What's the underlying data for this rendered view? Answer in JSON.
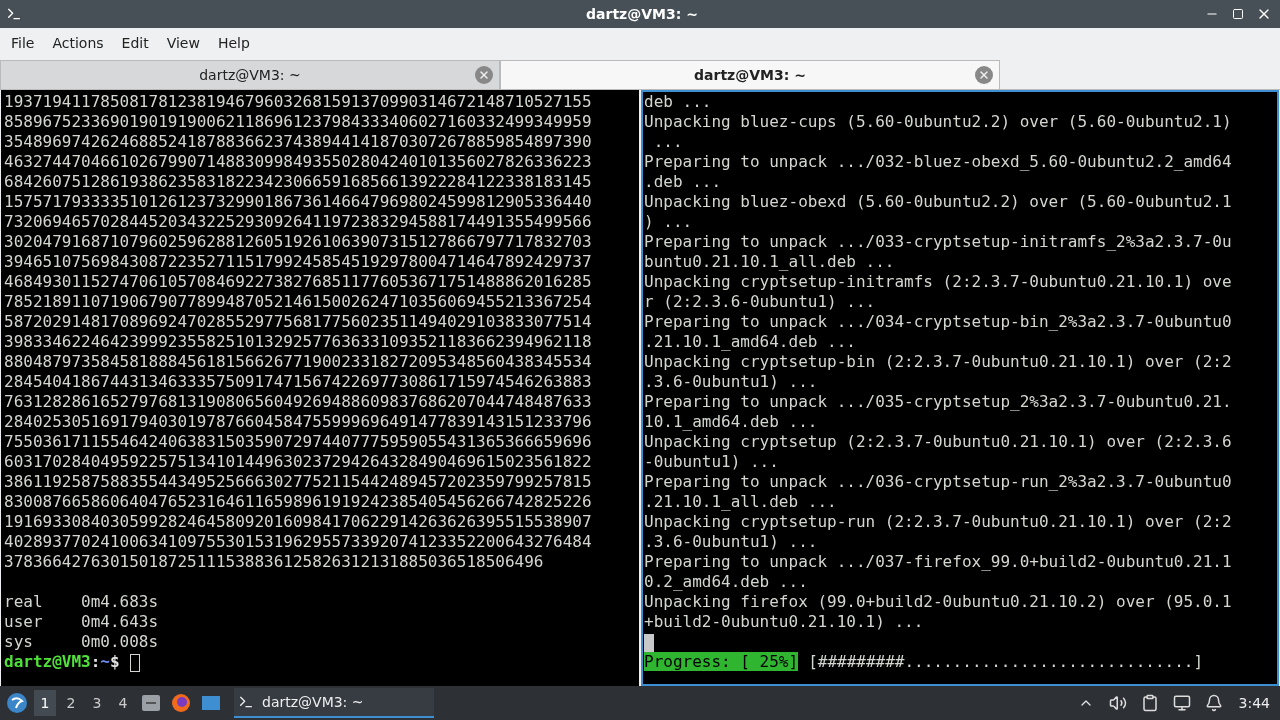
{
  "window": {
    "title": "dartz@VM3: ~"
  },
  "menu": [
    "File",
    "Actions",
    "Edit",
    "View",
    "Help"
  ],
  "tabs": [
    {
      "label": "dartz@VM3: ~",
      "selected": false
    },
    {
      "label": "dartz@VM3: ~",
      "selected": true
    }
  ],
  "panes": [
    {
      "active": false,
      "lines": [
        {
          "kind": "text",
          "text": "1937194117850817812381946796032681591370990314672148710527155"
        },
        {
          "kind": "text",
          "text": "8589675233690190191900621186961237984333406027160332499349959"
        },
        {
          "kind": "text",
          "text": "3548969742624688524187883662374389441418703072678859854897390"
        },
        {
          "kind": "text",
          "text": "4632744704661026799071488309984935502804240101356027826336223"
        },
        {
          "kind": "text",
          "text": "6842607512861938623583182234230665916856613922284122338183145"
        },
        {
          "kind": "text",
          "text": "1575717933335101261237329901867361466479698024599812905336440"
        },
        {
          "kind": "text",
          "text": "7320694657028445203432252930926411972383294588174491355499566"
        },
        {
          "kind": "text",
          "text": "3020479168710796025962881260519261063907315127866797717832703"
        },
        {
          "kind": "text",
          "text": "3946510756984308722352711517992458545192978004714647892429737"
        },
        {
          "kind": "text",
          "text": "4684930115274706105708469227382768511776053671751488862016285"
        },
        {
          "kind": "text",
          "text": "7852189110719067907789948705214615002624710356069455213367254"
        },
        {
          "kind": "text",
          "text": "5872029148170896924702855297756817756023511494029103833077514"
        },
        {
          "kind": "text",
          "text": "3983346224642399923558251013292577636331093521183662394962118"
        },
        {
          "kind": "text",
          "text": "8804879735845818884561815662677190023318272095348560438345534"
        },
        {
          "kind": "text",
          "text": "2845404186744313463335750917471567422697730861715974546263883"
        },
        {
          "kind": "text",
          "text": "7631282861652797681319080656049269488609837686207044748487633"
        },
        {
          "kind": "text",
          "text": "2840253051691794030197876604584755999696491477839143151233796"
        },
        {
          "kind": "text",
          "text": "7550361711554642406383150359072974407775959055431365366659696"
        },
        {
          "kind": "text",
          "text": "6031702840495922575134101449630237294264328490469615023561822"
        },
        {
          "kind": "text",
          "text": "3861192587588355443495256663027752115442489457202359799257815"
        },
        {
          "kind": "text",
          "text": "8300876658606404765231646116598961919242385405456266742825226"
        },
        {
          "kind": "text",
          "text": "1916933084030599282464580920160984170622914263626395515538907"
        },
        {
          "kind": "text",
          "text": "4028937702410063410975530153196295573392074123352200643276484"
        },
        {
          "kind": "text",
          "text": "37836642763015018725111538836125826312131885036518506496"
        },
        {
          "kind": "blank"
        },
        {
          "kind": "text",
          "text": "real\t0m4.683s"
        },
        {
          "kind": "text",
          "text": "user\t0m4.643s"
        },
        {
          "kind": "text",
          "text": "sys\t0m0.008s"
        },
        {
          "kind": "prompt",
          "user": "dartz@VM3",
          "sep": ":",
          "path": "~",
          "sign": "$"
        }
      ]
    },
    {
      "active": true,
      "lines": [
        {
          "kind": "text",
          "text": "deb ..."
        },
        {
          "kind": "text",
          "text": "Unpacking bluez-cups (5.60-0ubuntu2.2) over (5.60-0ubuntu2.1)"
        },
        {
          "kind": "text",
          "text": " ..."
        },
        {
          "kind": "text",
          "text": "Preparing to unpack .../032-bluez-obexd_5.60-0ubuntu2.2_amd64"
        },
        {
          "kind": "text",
          "text": ".deb ..."
        },
        {
          "kind": "text",
          "text": "Unpacking bluez-obexd (5.60-0ubuntu2.2) over (5.60-0ubuntu2.1"
        },
        {
          "kind": "text",
          "text": ") ..."
        },
        {
          "kind": "text",
          "text": "Preparing to unpack .../033-cryptsetup-initramfs_2%3a2.3.7-0u"
        },
        {
          "kind": "text",
          "text": "buntu0.21.10.1_all.deb ..."
        },
        {
          "kind": "text",
          "text": "Unpacking cryptsetup-initramfs (2:2.3.7-0ubuntu0.21.10.1) ove"
        },
        {
          "kind": "text",
          "text": "r (2:2.3.6-0ubuntu1) ..."
        },
        {
          "kind": "text",
          "text": "Preparing to unpack .../034-cryptsetup-bin_2%3a2.3.7-0ubuntu0"
        },
        {
          "kind": "text",
          "text": ".21.10.1_amd64.deb ..."
        },
        {
          "kind": "text",
          "text": "Unpacking cryptsetup-bin (2:2.3.7-0ubuntu0.21.10.1) over (2:2"
        },
        {
          "kind": "text",
          "text": ".3.6-0ubuntu1) ..."
        },
        {
          "kind": "text",
          "text": "Preparing to unpack .../035-cryptsetup_2%3a2.3.7-0ubuntu0.21."
        },
        {
          "kind": "text",
          "text": "10.1_amd64.deb ..."
        },
        {
          "kind": "text",
          "text": "Unpacking cryptsetup (2:2.3.7-0ubuntu0.21.10.1) over (2:2.3.6"
        },
        {
          "kind": "text",
          "text": "-0ubuntu1) ..."
        },
        {
          "kind": "text",
          "text": "Preparing to unpack .../036-cryptsetup-run_2%3a2.3.7-0ubuntu0"
        },
        {
          "kind": "text",
          "text": ".21.10.1_all.deb ..."
        },
        {
          "kind": "text",
          "text": "Unpacking cryptsetup-run (2:2.3.7-0ubuntu0.21.10.1) over (2:2"
        },
        {
          "kind": "text",
          "text": ".3.6-0ubuntu1) ..."
        },
        {
          "kind": "text",
          "text": "Preparing to unpack .../037-firefox_99.0+build2-0ubuntu0.21.1"
        },
        {
          "kind": "text",
          "text": "0.2_amd64.deb ..."
        },
        {
          "kind": "text",
          "text": "Unpacking firefox (99.0+build2-0ubuntu0.21.10.2) over (95.0.1"
        },
        {
          "kind": "text",
          "text": "+build2-0ubuntu0.21.10.1) ..."
        },
        {
          "kind": "cursor"
        },
        {
          "kind": "progress",
          "label": "Progress: [ 25%]",
          "bar": "[#########..............................]"
        }
      ]
    }
  ],
  "taskbar": {
    "workspaces": [
      {
        "label": "1",
        "selected": true
      },
      {
        "label": "2",
        "selected": false
      },
      {
        "label": "3",
        "selected": false
      },
      {
        "label": "4",
        "selected": false
      }
    ],
    "tasks": [
      {
        "label": "dartz@VM3: ~"
      }
    ],
    "clock": "3:44"
  }
}
